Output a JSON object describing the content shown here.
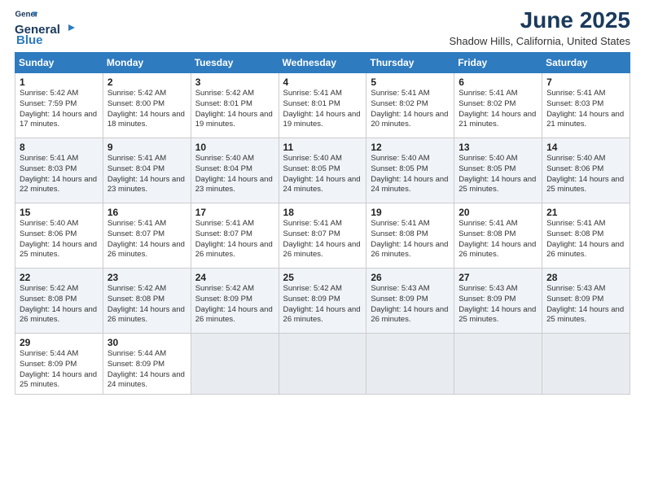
{
  "logo": {
    "line1": "General",
    "line2": "Blue"
  },
  "title": "June 2025",
  "location": "Shadow Hills, California, United States",
  "days_of_week": [
    "Sunday",
    "Monday",
    "Tuesday",
    "Wednesday",
    "Thursday",
    "Friday",
    "Saturday"
  ],
  "weeks": [
    [
      {
        "day": 1,
        "rise": "5:42 AM",
        "set": "7:59 PM",
        "hours": "14 hours and 17 minutes"
      },
      {
        "day": 2,
        "rise": "5:42 AM",
        "set": "8:00 PM",
        "hours": "14 hours and 18 minutes"
      },
      {
        "day": 3,
        "rise": "5:42 AM",
        "set": "8:01 PM",
        "hours": "14 hours and 19 minutes"
      },
      {
        "day": 4,
        "rise": "5:41 AM",
        "set": "8:01 PM",
        "hours": "14 hours and 19 minutes"
      },
      {
        "day": 5,
        "rise": "5:41 AM",
        "set": "8:02 PM",
        "hours": "14 hours and 20 minutes"
      },
      {
        "day": 6,
        "rise": "5:41 AM",
        "set": "8:02 PM",
        "hours": "14 hours and 21 minutes"
      },
      {
        "day": 7,
        "rise": "5:41 AM",
        "set": "8:03 PM",
        "hours": "14 hours and 21 minutes"
      }
    ],
    [
      {
        "day": 8,
        "rise": "5:41 AM",
        "set": "8:03 PM",
        "hours": "14 hours and 22 minutes"
      },
      {
        "day": 9,
        "rise": "5:41 AM",
        "set": "8:04 PM",
        "hours": "14 hours and 23 minutes"
      },
      {
        "day": 10,
        "rise": "5:40 AM",
        "set": "8:04 PM",
        "hours": "14 hours and 23 minutes"
      },
      {
        "day": 11,
        "rise": "5:40 AM",
        "set": "8:05 PM",
        "hours": "14 hours and 24 minutes"
      },
      {
        "day": 12,
        "rise": "5:40 AM",
        "set": "8:05 PM",
        "hours": "14 hours and 24 minutes"
      },
      {
        "day": 13,
        "rise": "5:40 AM",
        "set": "8:05 PM",
        "hours": "14 hours and 25 minutes"
      },
      {
        "day": 14,
        "rise": "5:40 AM",
        "set": "8:06 PM",
        "hours": "14 hours and 25 minutes"
      }
    ],
    [
      {
        "day": 15,
        "rise": "5:40 AM",
        "set": "8:06 PM",
        "hours": "14 hours and 25 minutes"
      },
      {
        "day": 16,
        "rise": "5:41 AM",
        "set": "8:07 PM",
        "hours": "14 hours and 26 minutes"
      },
      {
        "day": 17,
        "rise": "5:41 AM",
        "set": "8:07 PM",
        "hours": "14 hours and 26 minutes"
      },
      {
        "day": 18,
        "rise": "5:41 AM",
        "set": "8:07 PM",
        "hours": "14 hours and 26 minutes"
      },
      {
        "day": 19,
        "rise": "5:41 AM",
        "set": "8:08 PM",
        "hours": "14 hours and 26 minutes"
      },
      {
        "day": 20,
        "rise": "5:41 AM",
        "set": "8:08 PM",
        "hours": "14 hours and 26 minutes"
      },
      {
        "day": 21,
        "rise": "5:41 AM",
        "set": "8:08 PM",
        "hours": "14 hours and 26 minutes"
      }
    ],
    [
      {
        "day": 22,
        "rise": "5:42 AM",
        "set": "8:08 PM",
        "hours": "14 hours and 26 minutes"
      },
      {
        "day": 23,
        "rise": "5:42 AM",
        "set": "8:08 PM",
        "hours": "14 hours and 26 minutes"
      },
      {
        "day": 24,
        "rise": "5:42 AM",
        "set": "8:09 PM",
        "hours": "14 hours and 26 minutes"
      },
      {
        "day": 25,
        "rise": "5:42 AM",
        "set": "8:09 PM",
        "hours": "14 hours and 26 minutes"
      },
      {
        "day": 26,
        "rise": "5:43 AM",
        "set": "8:09 PM",
        "hours": "14 hours and 26 minutes"
      },
      {
        "day": 27,
        "rise": "5:43 AM",
        "set": "8:09 PM",
        "hours": "14 hours and 25 minutes"
      },
      {
        "day": 28,
        "rise": "5:43 AM",
        "set": "8:09 PM",
        "hours": "14 hours and 25 minutes"
      }
    ],
    [
      {
        "day": 29,
        "rise": "5:44 AM",
        "set": "8:09 PM",
        "hours": "14 hours and 25 minutes"
      },
      {
        "day": 30,
        "rise": "5:44 AM",
        "set": "8:09 PM",
        "hours": "14 hours and 24 minutes"
      },
      null,
      null,
      null,
      null,
      null
    ]
  ]
}
